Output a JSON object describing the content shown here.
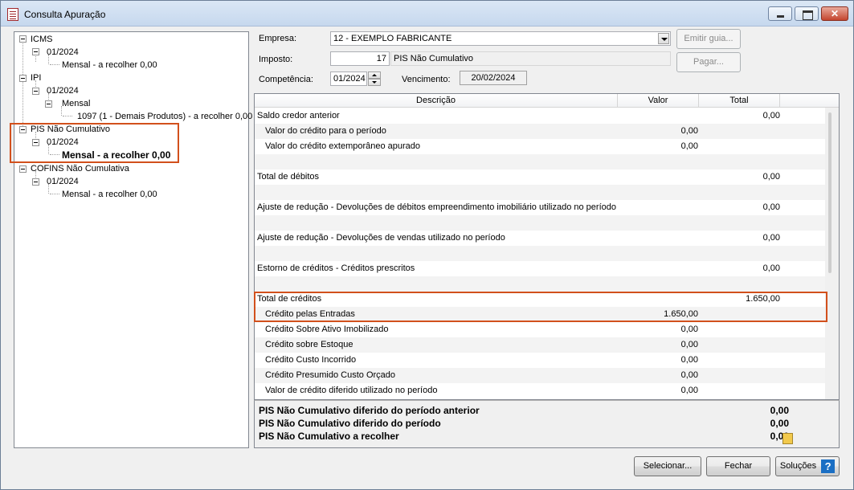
{
  "window": {
    "title": "Consulta Apuração"
  },
  "tree": [
    {
      "label": "ICMS"
    },
    {
      "label": "01/2024"
    },
    {
      "label": "Mensal - a recolher 0,00"
    },
    {
      "label": "IPI"
    },
    {
      "label": "01/2024"
    },
    {
      "label": "Mensal"
    },
    {
      "label": "1097 (1 - Demais Produtos) - a recolher 0,00"
    },
    {
      "label": "PIS Não Cumulativo"
    },
    {
      "label": "01/2024"
    },
    {
      "label": "Mensal - a recolher 0,00"
    },
    {
      "label": "COFINS Não Cumulativa"
    },
    {
      "label": "01/2024"
    },
    {
      "label": "Mensal - a recolher 0,00"
    }
  ],
  "form": {
    "empresa_label": "Empresa:",
    "empresa_value": "12 - EXEMPLO FABRICANTE",
    "imposto_label": "Imposto:",
    "imposto_code": "17",
    "imposto_name": "PIS Não Cumulativo",
    "competencia_label": "Competência:",
    "competencia_value": "01/2024",
    "vencimento_label": "Vencimento:",
    "vencimento_value": "20/02/2024"
  },
  "buttons": {
    "emitir_guia": "Emitir guia...",
    "pagar": "Pagar...",
    "selecionar": "Selecionar...",
    "fechar": "Fechar",
    "solucoes": "Soluções",
    "help": "?"
  },
  "grid": {
    "headers": {
      "descricao": "Descrição",
      "valor": "Valor",
      "total": "Total"
    },
    "rows": [
      {
        "desc": "Saldo credor anterior",
        "valor": "",
        "total": "0,00"
      },
      {
        "desc": "Valor do crédito para o período",
        "valor": "0,00",
        "total": ""
      },
      {
        "desc": "Valor do crédito extemporâneo apurado",
        "valor": "0,00",
        "total": ""
      },
      {
        "desc": "",
        "valor": "",
        "total": ""
      },
      {
        "desc": "Total de débitos",
        "valor": "",
        "total": "0,00"
      },
      {
        "desc": "",
        "valor": "",
        "total": ""
      },
      {
        "desc": "Ajuste de redução - Devoluções de débitos empreendimento imobiliário utilizado no período",
        "valor": "",
        "total": "0,00"
      },
      {
        "desc": "",
        "valor": "",
        "total": ""
      },
      {
        "desc": "Ajuste de redução - Devoluções de vendas utilizado no período",
        "valor": "",
        "total": "0,00"
      },
      {
        "desc": "",
        "valor": "",
        "total": ""
      },
      {
        "desc": "Estorno de créditos - Créditos prescritos",
        "valor": "",
        "total": "0,00"
      },
      {
        "desc": "",
        "valor": "",
        "total": ""
      },
      {
        "desc": "Total de créditos",
        "valor": "",
        "total": "1.650,00"
      },
      {
        "desc": "Crédito pelas Entradas",
        "valor": "1.650,00",
        "total": ""
      },
      {
        "desc": "Crédito Sobre Ativo Imobilizado",
        "valor": "0,00",
        "total": ""
      },
      {
        "desc": "Crédito sobre Estoque",
        "valor": "0,00",
        "total": ""
      },
      {
        "desc": "Crédito Custo Incorrido",
        "valor": "0,00",
        "total": ""
      },
      {
        "desc": "Crédito Presumido Custo Orçado",
        "valor": "0,00",
        "total": ""
      },
      {
        "desc": "Valor de crédito diferido utilizado no período",
        "valor": "0,00",
        "total": ""
      }
    ]
  },
  "summary": [
    {
      "label": "PIS Não Cumulativo diferido do período anterior",
      "value": "0,00"
    },
    {
      "label": "PIS Não Cumulativo diferido do período",
      "value": "0,00"
    },
    {
      "label": "PIS Não Cumulativo a recolher",
      "value": "0,00"
    }
  ],
  "colors": {
    "highlight": "#d2501c",
    "title_gradient": "#c6d8ee"
  }
}
